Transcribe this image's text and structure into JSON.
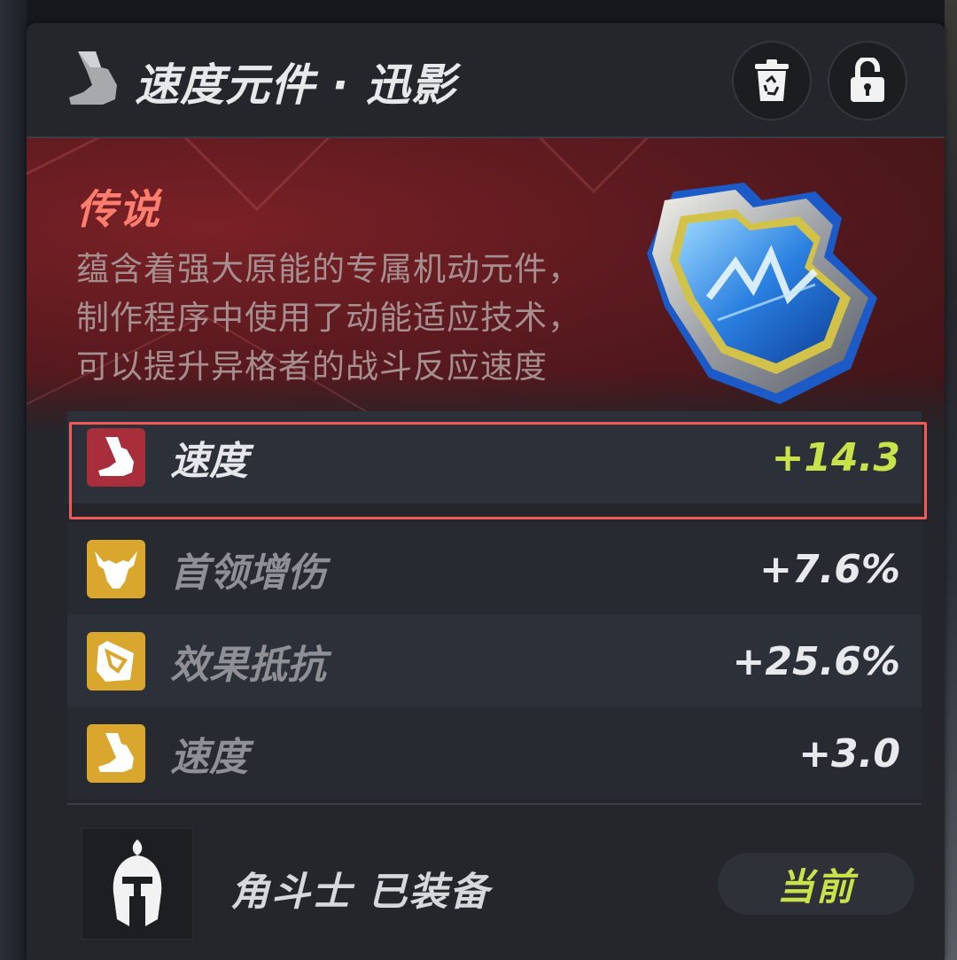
{
  "header": {
    "title": "速度元件 · 迅影",
    "icon": "speed-boot-icon",
    "buttons": [
      {
        "icon": "recycle-trash-icon"
      },
      {
        "icon": "unlocked-padlock-icon"
      }
    ]
  },
  "hero": {
    "rarity": "传说",
    "description": "蕴含着强大原能的专属机动元件，制作程序中使用了动能适应技术，可以提升异格者的战斗反应速度",
    "image": "legendary-module-crystal"
  },
  "stats": [
    {
      "name": "速度",
      "value": "+14.3",
      "icon": "speed-boot-icon",
      "icon_color": "#a82e3c",
      "primary": true
    },
    {
      "name": "首领增伤",
      "value": "+7.6%",
      "icon": "bull-head-icon",
      "icon_color": "#d9a62e",
      "primary": false
    },
    {
      "name": "效果抵抗",
      "value": "+25.6%",
      "icon": "shield-resist-icon",
      "icon_color": "#d9a62e",
      "primary": false
    },
    {
      "name": "速度",
      "value": "+3.0",
      "icon": "speed-boot-icon",
      "icon_color": "#d9a62e",
      "primary": false
    }
  ],
  "equip": {
    "avatar_icon": "spartan-helmet-icon",
    "text": "角斗士 已装备",
    "current_button": "当前"
  },
  "colors": {
    "rarity": "#ff7d6f",
    "highlight_border": "#f05a57",
    "main_stat_value": "#c8e34a",
    "current_button_text": "#c8e34a"
  }
}
